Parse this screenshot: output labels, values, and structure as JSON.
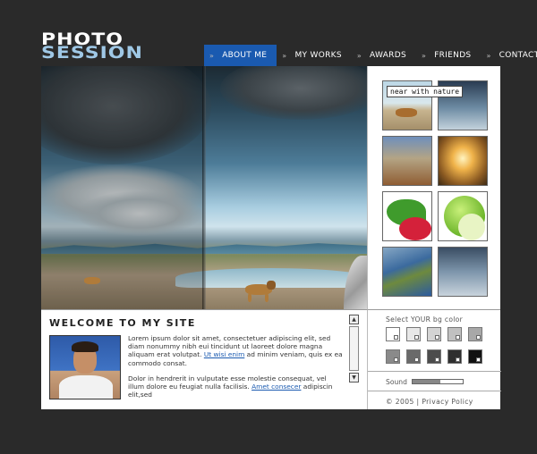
{
  "logo": {
    "line1": "PHOTO",
    "line2": "SESSION"
  },
  "nav": [
    {
      "label": "ABOUT ME",
      "active": true
    },
    {
      "label": "MY WORKS",
      "active": false
    },
    {
      "label": "AWARDS",
      "active": false
    },
    {
      "label": "FRIENDS",
      "active": false
    },
    {
      "label": "CONTACTS",
      "active": false
    }
  ],
  "nav_bullet": "»",
  "gallery": {
    "tooltip": "near with nature",
    "thumbs": [
      "lion-on-beach",
      "storm-sky",
      "canyon",
      "sunset-field",
      "strawberry",
      "green-apple",
      "coastline",
      "stormy-clouds"
    ]
  },
  "welcome": {
    "title": "WELCOME TO MY SITE",
    "p1_text": "Lorem ipsum dolor sit amet, consectetuer adipiscing elit, sed diam nonummy nibh eui tincidunt ut laoreet dolore magna aliquam erat volutpat.",
    "p1_link": "Ut wisi enim",
    "p1_tail": "ad minim veniam, quis ex ea commodo consat.",
    "p2_text": "Dolor in hendrerit in vulputate esse molestie consequat, vel illum dolore eu feugiat nulla facilisis.",
    "p2_link": "Amet consecer",
    "p2_tail": "adipiscin elit,sed"
  },
  "scroll": {
    "up": "▲",
    "down": "▼"
  },
  "bg_color": {
    "label": "Select YOUR bg color",
    "swatches": [
      "#ffffff",
      "#e8e8e8",
      "#d4d4d4",
      "#c0c0c0",
      "#a8a8a8",
      "#8a8a8a",
      "#6a6a6a",
      "#4c4c4c",
      "#2f2f2f",
      "#111111"
    ]
  },
  "sound": {
    "label": "Sound",
    "level": 0.55
  },
  "copyright": "© 2005 | Privacy Policy"
}
